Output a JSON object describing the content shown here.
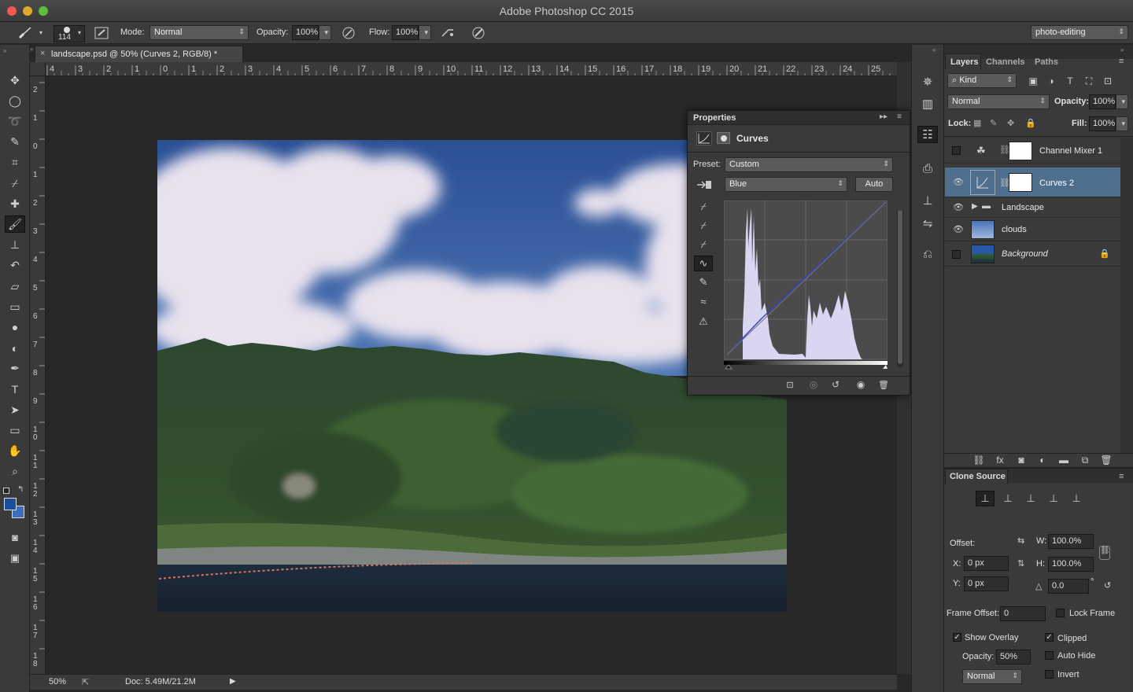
{
  "app": {
    "title": "Adobe Photoshop CC 2015"
  },
  "options_bar": {
    "brush_size": "114",
    "mode_label": "Mode:",
    "mode_value": "Normal",
    "opacity_label": "Opacity:",
    "opacity_value": "100%",
    "flow_label": "Flow:",
    "flow_value": "100%",
    "workspace": "photo-editing"
  },
  "document": {
    "tab_title": "landscape.psd @ 50% (Curves 2, RGB/8) *",
    "zoom": "50%",
    "doc_info": "Doc: 5.49M/21.2M",
    "hruler_labels": [
      "4",
      "3",
      "2",
      "1",
      "0",
      "1",
      "2",
      "3",
      "4",
      "5",
      "6",
      "7",
      "8",
      "9",
      "10",
      "11",
      "12",
      "13",
      "14",
      "15",
      "16",
      "17",
      "18",
      "19",
      "20",
      "21",
      "22",
      "23",
      "24",
      "25"
    ],
    "vruler_labels": [
      "2",
      "1",
      "0",
      "1",
      "2",
      "3",
      "4",
      "5",
      "6",
      "7",
      "8",
      "9",
      "10",
      "11",
      "12",
      "13",
      "14",
      "15",
      "16",
      "17",
      "18"
    ]
  },
  "properties": {
    "panel_title": "Properties",
    "adjustment_name": "Curves",
    "preset_label": "Preset:",
    "preset_value": "Custom",
    "channel_value": "Blue",
    "auto_label": "Auto"
  },
  "layers_panel": {
    "tabs": [
      "Layers",
      "Channels",
      "Paths"
    ],
    "filter_kind": "Kind",
    "blend_mode": "Normal",
    "opacity_label": "Opacity:",
    "opacity_value": "100%",
    "lock_label": "Lock:",
    "fill_label": "Fill:",
    "fill_value": "100%",
    "layers": [
      {
        "name": "Channel Mixer 1",
        "visible": false
      },
      {
        "name": "Curves 2",
        "visible": true,
        "selected": true
      },
      {
        "name": "Landscape",
        "visible": true
      },
      {
        "name": "clouds",
        "visible": true
      },
      {
        "name": "Background",
        "visible": false
      }
    ]
  },
  "clone_source": {
    "title": "Clone Source",
    "offset_label": "Offset:",
    "w_label": "W:",
    "w_value": "100.0%",
    "h_label": "H:",
    "h_value": "100.0%",
    "x_label": "X:",
    "x_value": "0 px",
    "y_label": "Y:",
    "y_value": "0 px",
    "angle_value": "0.0",
    "angle_unit": "°",
    "frame_offset_label": "Frame Offset:",
    "frame_offset_value": "0",
    "lock_frame_label": "Lock Frame",
    "show_overlay_label": "Show Overlay",
    "clipped_label": "Clipped",
    "opacity_label": "Opacity:",
    "opacity_value": "50%",
    "auto_hide_label": "Auto Hide",
    "invert_label": "Invert",
    "blend_value": "Normal"
  },
  "colors": {
    "accent_selected": "#4f6f8f",
    "foreground_swatch": "#1c4f9a"
  }
}
